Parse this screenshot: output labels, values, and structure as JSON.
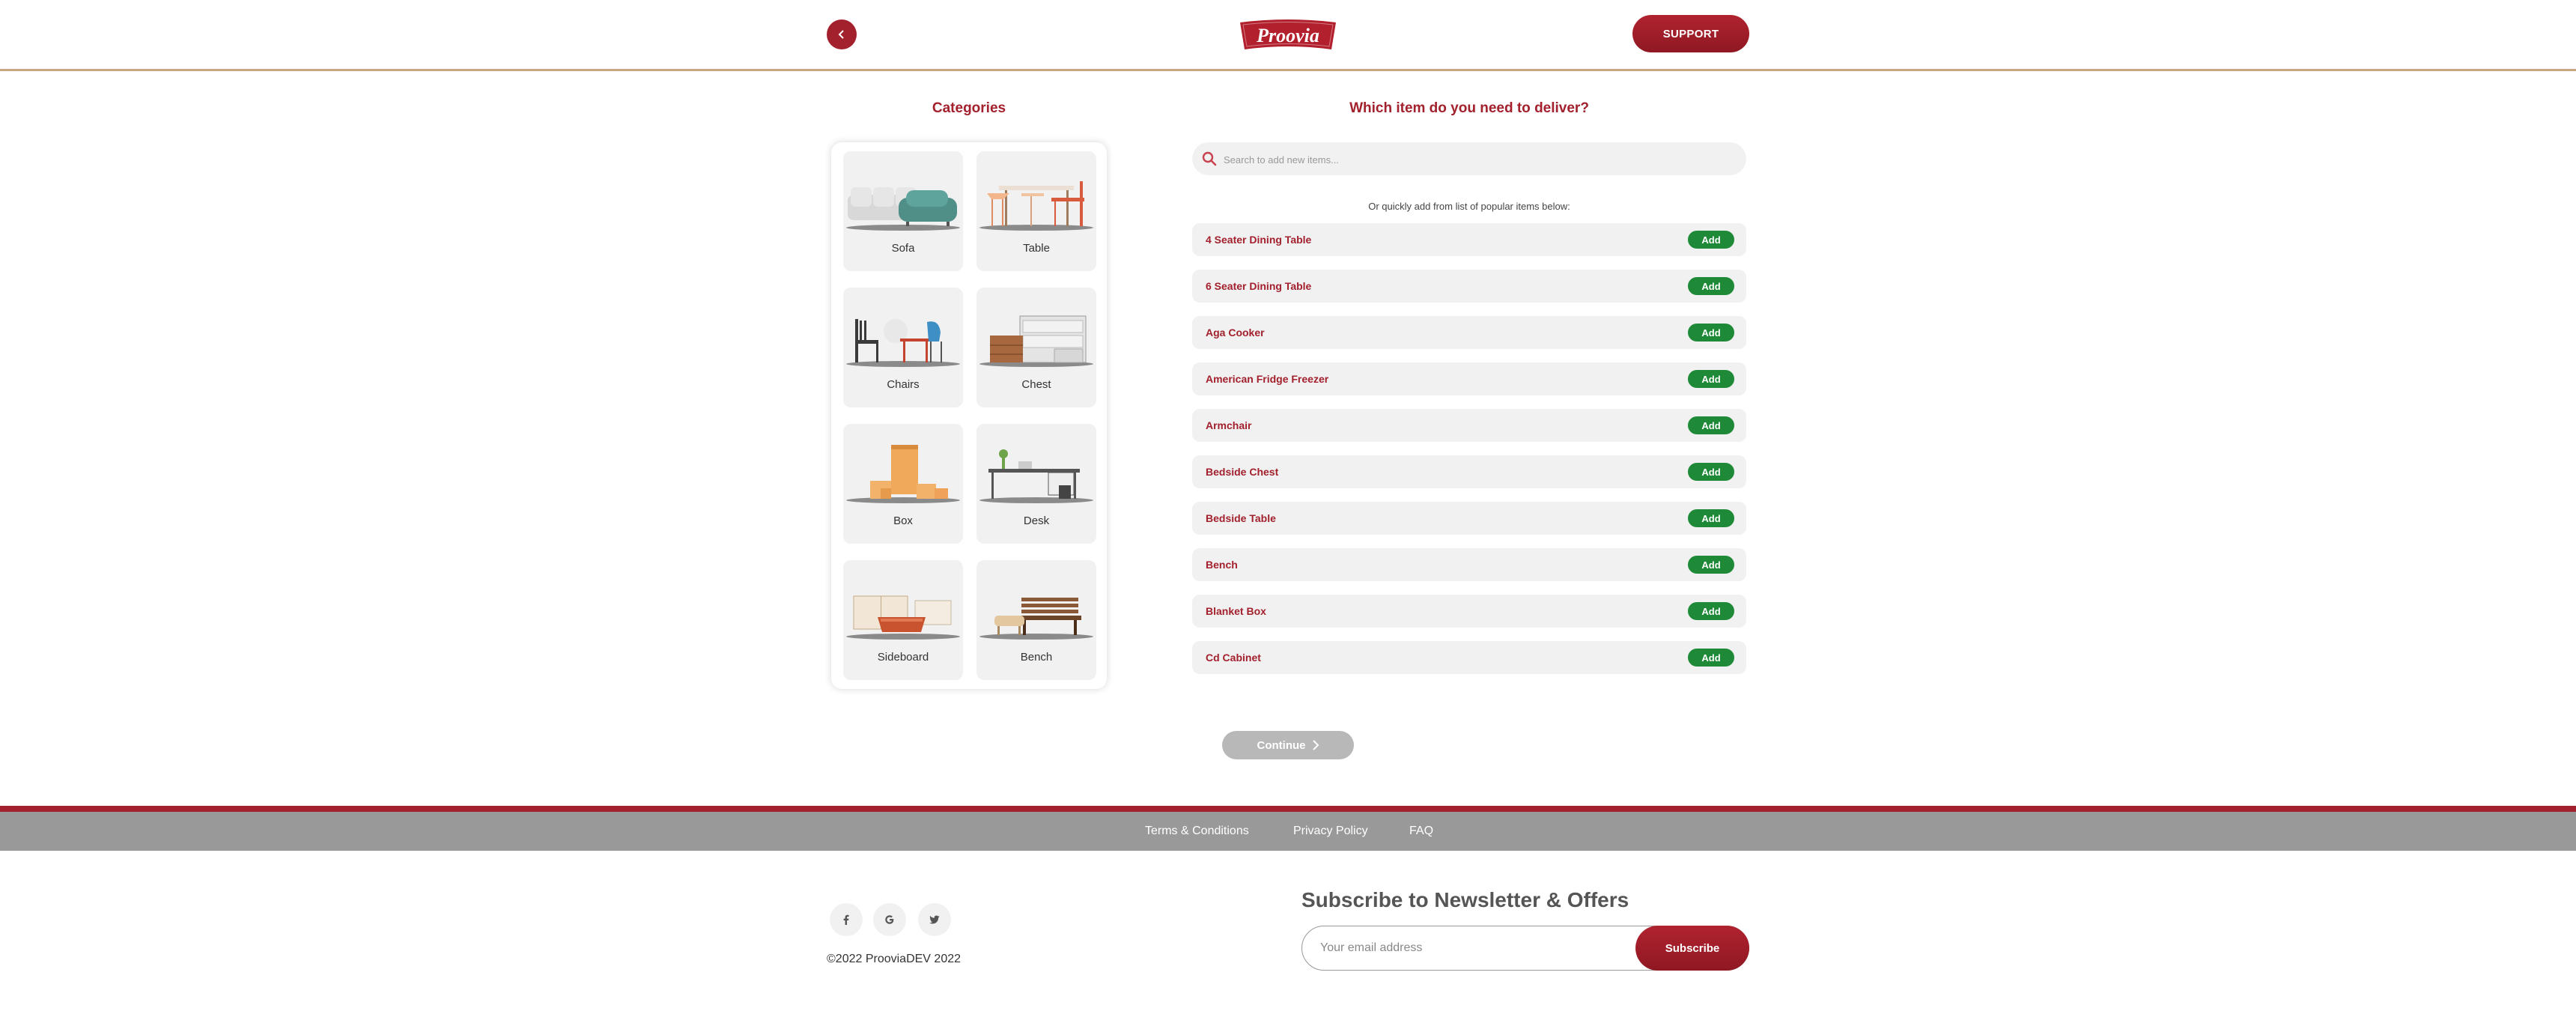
{
  "header": {
    "logo_text": "Proovia",
    "support_label": "SUPPORT",
    "brand_color": "#a3202d"
  },
  "categories": {
    "title": "Categories",
    "items": [
      {
        "label": "Sofa",
        "icon": "sofa-icon"
      },
      {
        "label": "Table",
        "icon": "table-icon"
      },
      {
        "label": "Chairs",
        "icon": "chairs-icon"
      },
      {
        "label": "Chest",
        "icon": "chest-icon"
      },
      {
        "label": "Box",
        "icon": "box-icon"
      },
      {
        "label": "Desk",
        "icon": "desk-icon"
      },
      {
        "label": "Sideboard",
        "icon": "sideboard-icon"
      },
      {
        "label": "Bench",
        "icon": "bench-icon"
      }
    ]
  },
  "items_panel": {
    "title": "Which item do you need to deliver?",
    "search_placeholder": "Search to add new items...",
    "quick_text": "Or quickly add from list of popular items below:",
    "add_label": "Add",
    "add_color": "#1e8a38",
    "list": [
      "4 Seater Dining Table",
      "6 Seater Dining Table",
      "Aga Cooker",
      "American Fridge Freezer",
      "Armchair",
      "Bedside Chest",
      "Bedside Table",
      "Bench",
      "Blanket Box",
      "Cd Cabinet"
    ],
    "continue_label": "Continue"
  },
  "footer": {
    "links": [
      "Terms & Conditions",
      "Privacy Policy",
      "FAQ"
    ],
    "social": [
      "facebook-icon",
      "google-icon",
      "twitter-icon"
    ],
    "copyright": "©2022 ProoviaDEV 2022",
    "newsletter_title": "Subscribe to Newsletter & Offers",
    "email_placeholder": "Your email address",
    "subscribe_label": "Subscribe"
  }
}
